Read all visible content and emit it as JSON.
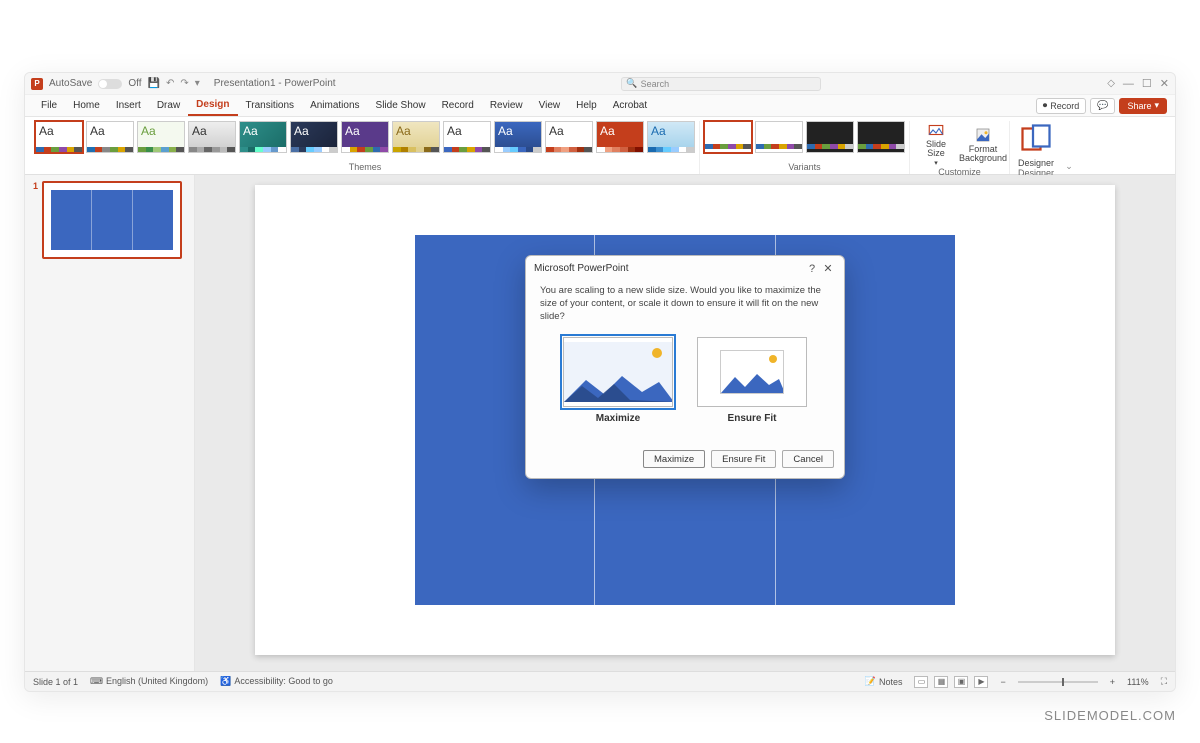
{
  "titlebar": {
    "autosave_label": "AutoSave",
    "autosave_state": "Off",
    "doc_title": "Presentation1 - PowerPoint",
    "search_placeholder": "Search"
  },
  "ribbon_tabs": [
    "File",
    "Home",
    "Insert",
    "Draw",
    "Design",
    "Transitions",
    "Animations",
    "Slide Show",
    "Record",
    "Review",
    "View",
    "Help",
    "Acrobat"
  ],
  "active_tab": "Design",
  "ribbon_right": {
    "record": "Record",
    "share": "Share"
  },
  "themes_label": "Themes",
  "variants_label": "Variants",
  "customize_label": "Customize",
  "designer_group_label": "Designer",
  "customize": {
    "slide_size": "Slide\nSize",
    "format_bg": "Format\nBackground"
  },
  "designer_btn": "Designer",
  "themes": [
    {
      "aa": "Aa",
      "aa_color": "#333",
      "bg": "#fff",
      "bar": [
        "#2e6bb0",
        "#c43e1c",
        "#6a9e3e",
        "#8f4aa8",
        "#d9a400",
        "#555"
      ],
      "selected": true
    },
    {
      "aa": "Aa",
      "aa_color": "#333",
      "bg": "#fff",
      "bar": [
        "#1f6fb2",
        "#c43e1c",
        "#888",
        "#6a9e3e",
        "#d9a400",
        "#555"
      ]
    },
    {
      "aa": "Aa",
      "aa_color": "#6a9e3e",
      "bg": "#f4f9ef",
      "bar": [
        "#6a9e3e",
        "#3b8f4a",
        "#a0c878",
        "#5aa0d0",
        "#88b04b",
        "#555"
      ]
    },
    {
      "aa": "Aa",
      "aa_color": "#333",
      "bg": "linear-gradient(#eee,#ccc)",
      "bar": [
        "#888",
        "#aaa",
        "#666",
        "#999",
        "#bbb",
        "#555"
      ]
    },
    {
      "aa": "Aa",
      "aa_color": "#fff",
      "bg": "linear-gradient(135deg,#2e8f8a,#1a6b66)",
      "bar": [
        "#2e8f8a",
        "#1a6b66",
        "#6fc",
        "#9cf",
        "#69c",
        "#fff"
      ]
    },
    {
      "aa": "Aa",
      "aa_color": "#fff",
      "bg": "linear-gradient(135deg,#2b3a5a,#1a2238)",
      "bar": [
        "#4a6fa5",
        "#2b3a5a",
        "#6cf",
        "#9cf",
        "#fff",
        "#ccc"
      ]
    },
    {
      "aa": "Aa",
      "aa_color": "#fff",
      "bg": "#5a3a8a",
      "bar": [
        "#fff",
        "#d9a400",
        "#c43e1c",
        "#6a9e3e",
        "#2e6bb0",
        "#8f4aa8"
      ]
    },
    {
      "aa": "Aa",
      "aa_color": "#8a6a1a",
      "bg": "linear-gradient(#f0e6c0,#e0d090)",
      "bar": [
        "#c9a400",
        "#b08000",
        "#d9c060",
        "#e0d090",
        "#8a6a1a",
        "#555"
      ]
    },
    {
      "aa": "Aa",
      "aa_color": "#333",
      "bg": "#fff",
      "bar": [
        "#3b67bf",
        "#c43e1c",
        "#6a9e3e",
        "#d9a400",
        "#8f4aa8",
        "#555"
      ]
    },
    {
      "aa": "Aa",
      "aa_color": "#fff",
      "bg": "linear-gradient(#3b67bf,#2a4a8a)",
      "bar": [
        "#fff",
        "#9cf",
        "#6cf",
        "#3b67bf",
        "#2a4a8a",
        "#ccc"
      ]
    },
    {
      "aa": "Aa",
      "aa_color": "#333",
      "bg": "#fff",
      "bar": [
        "#c43e1c",
        "#e08060",
        "#f0a080",
        "#d06040",
        "#a03010",
        "#555"
      ]
    },
    {
      "aa": "Aa",
      "aa_color": "#fff",
      "bg": "#c43e1c",
      "bar": [
        "#fff",
        "#f0a080",
        "#e08060",
        "#d06040",
        "#a03010",
        "#801000"
      ]
    },
    {
      "aa": "Aa",
      "aa_color": "#1a6bb0",
      "bg": "linear-gradient(#d0e8f6,#a0d0ea)",
      "bar": [
        "#1a6bb0",
        "#3b8fd0",
        "#6cf",
        "#9cf",
        "#fff",
        "#ccc"
      ]
    }
  ],
  "variants": [
    {
      "bg": "#fff",
      "bar": [
        "#2e6bb0",
        "#c43e1c",
        "#6a9e3e",
        "#8f4aa8",
        "#d9a400",
        "#555"
      ],
      "selected": true
    },
    {
      "bg": "#fff",
      "bar": [
        "#2e6bb0",
        "#6a9e3e",
        "#c43e1c",
        "#d9a400",
        "#8f4aa8",
        "#555"
      ]
    },
    {
      "bg": "#222",
      "bar": [
        "#2e6bb0",
        "#c43e1c",
        "#6a9e3e",
        "#8f4aa8",
        "#d9a400",
        "#ccc"
      ]
    },
    {
      "bg": "#222",
      "bar": [
        "#6a9e3e",
        "#2e6bb0",
        "#c43e1c",
        "#d9a400",
        "#8f4aa8",
        "#ccc"
      ]
    }
  ],
  "thumb_rail": {
    "slide_number": "1"
  },
  "dialog": {
    "title": "Microsoft PowerPoint",
    "message": "You are scaling to a new slide size.  Would you like to maximize the size of your content, or scale it down to ensure it will fit on the new slide?",
    "opt_maximize": "Maximize",
    "opt_ensure_fit": "Ensure Fit",
    "btn_maximize": "Maximize",
    "btn_ensure_fit": "Ensure Fit",
    "btn_cancel": "Cancel",
    "help": "?",
    "close": "✕"
  },
  "status": {
    "slide_info": "Slide 1 of 1",
    "language": "English (United Kingdom)",
    "accessibility": "Accessibility: Good to go",
    "notes": "Notes",
    "zoom": "111%"
  },
  "watermark": "SLIDEMODEL.COM"
}
